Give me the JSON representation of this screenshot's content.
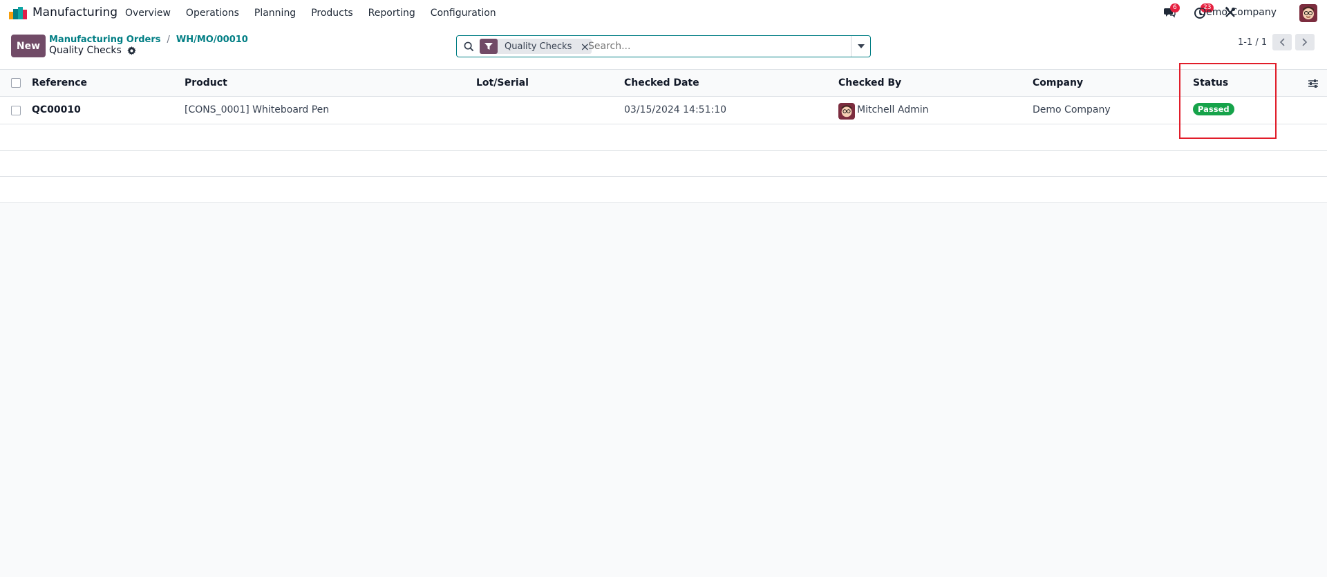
{
  "navbar": {
    "app_name": "Manufacturing",
    "menu": [
      "Overview",
      "Operations",
      "Planning",
      "Products",
      "Reporting",
      "Configuration"
    ],
    "messages_count": "6",
    "activities_count": "23",
    "company": "Demo Company"
  },
  "control": {
    "new_label": "New",
    "breadcrumb": [
      "Manufacturing Orders",
      "WH/MO/00010"
    ],
    "breadcrumb_sep": "/",
    "title": "Quality Checks",
    "search": {
      "facet_label": "Quality Checks",
      "remove_glyph": "×",
      "placeholder": "Search..."
    },
    "pager": "1-1 / 1"
  },
  "list": {
    "columns": [
      "Reference",
      "Product",
      "Lot/Serial",
      "Checked Date",
      "Checked By",
      "Company",
      "Status"
    ],
    "rows": [
      {
        "reference": "QC00010",
        "product": "[CONS_0001] Whiteboard Pen",
        "lot_serial": "",
        "checked_date": "03/15/2024 14:51:10",
        "checked_by": "Mitchell Admin",
        "company": "Demo Company",
        "status": "Passed"
      }
    ]
  },
  "colors": {
    "brand": "#714b67",
    "link": "#017e84",
    "status_passed": "#16a34a",
    "badge": "#e6203f",
    "highlight": "#e11d2a"
  },
  "icons": [
    "app-logo-icon",
    "chat-icon",
    "clock-icon",
    "tools-icon",
    "gear-icon",
    "search-icon",
    "filter-icon",
    "caret-down-icon",
    "chevron-left-icon",
    "chevron-right-icon",
    "sliders-icon"
  ]
}
